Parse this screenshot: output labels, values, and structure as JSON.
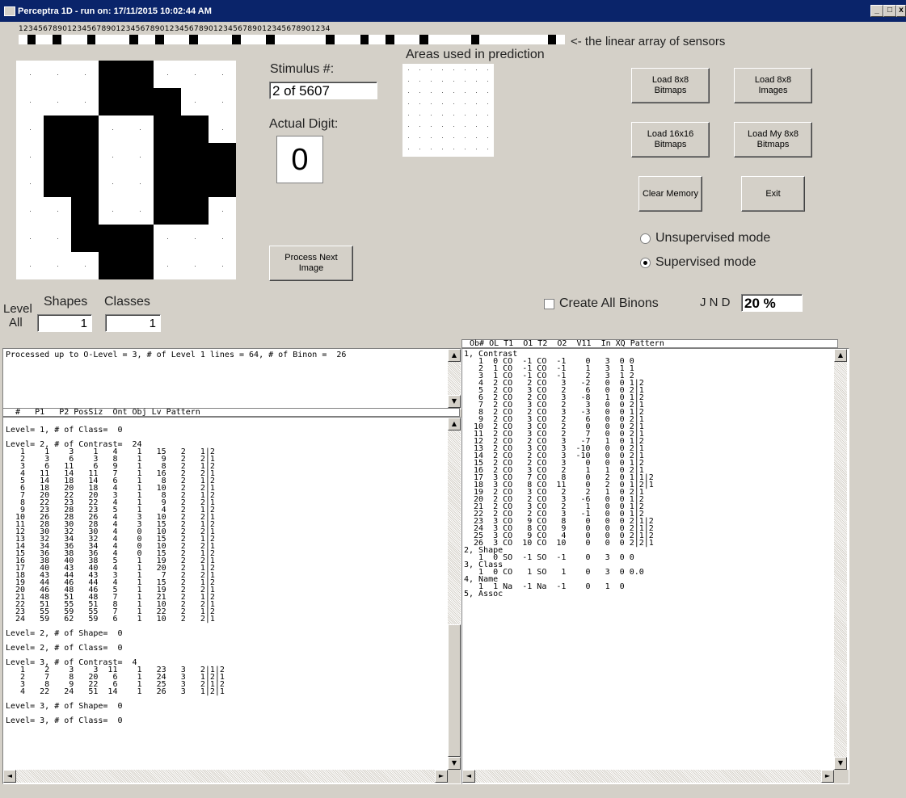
{
  "window": {
    "title": "Perceptra 1D - run on: 17/11/2015  10:02:44 AM"
  },
  "sensors": {
    "ruler_digits": "1234567890123456789012345678901234567890123456789012345678901234",
    "label": "<- the linear array of sensors",
    "pattern": "0100100010000100100010000100010000001000100100010000010000000010"
  },
  "bitmap": {
    "rows": [
      "00011000",
      "00011100",
      "01100110",
      "01100111",
      "01100111",
      "00100110",
      "00111000",
      "00011000"
    ]
  },
  "stimulus": {
    "label": "Stimulus #:",
    "value": "2  of 5607"
  },
  "actual_digit": {
    "label": "Actual Digit:",
    "value": "0"
  },
  "areas": {
    "label": "Areas used in prediction"
  },
  "buttons": {
    "load_8x8_bitmaps": "Load 8x8\nBitmaps",
    "load_8x8_images": "Load 8x8\nImages",
    "load_16x16_bitmaps": "Load 16x16\nBitmaps",
    "load_my_8x8_bitmaps": "Load My 8x8\nBitmaps",
    "clear_memory": "Clear Memory",
    "exit": "Exit",
    "process_next_image": "Process Next\nImage"
  },
  "modes": {
    "unsupervised": "Unsupervised mode",
    "supervised": "Supervised mode",
    "selected": "supervised"
  },
  "create_all_binons": {
    "label": "Create All Binons",
    "checked": false
  },
  "jnd": {
    "label": "J N D",
    "value": "20 %"
  },
  "level": {
    "label": "Level",
    "all": "All",
    "shapes_label": "Shapes",
    "shapes_value": "1",
    "classes_label": "Classes",
    "classes_value": "1"
  },
  "status": {
    "text": "Processed up to O-Level = 3, # of Level 1 lines = 64, # of Binon =  26"
  },
  "level_list": {
    "header": "  #   P1   P2 PosSiz  Ont Obj Lv Pattern",
    "text": "\nLevel= 1, # of Class=  0\n\nLevel= 2, # of Contrast=  24\n   1    1    3    1   4    1   15   2   1|2\n   2    3    6    3   8    1    9   2   2|1\n   3    6   11    6   9    1    8   2   1|2\n   4   11   14   11   7    1   16   2   2|1\n   5   14   18   14   6    1    8   2   1|2\n   6   18   20   18   4    1   10   2   2|1\n   7   20   22   20   3    1    8   2   1|2\n   8   22   23   22   4    1    9   2   2|1\n   9   23   28   23   5    1    4   2   1|2\n  10   26   28   26   4    3   10   2   2|1\n  11   28   30   28   4    3   15   2   1|2\n  12   30   32   30   4    0   10   2   2|1\n  13   32   34   32   4    0   15   2   1|2\n  14   34   36   34   4    0   10   2   2|1\n  15   36   38   36   4    0   15   2   1|2\n  16   38   40   38   5    1   19   2   2|1\n  17   40   43   40   4    1   20   2   1|2\n  18   43   44   43   3    1    7   2   2|1\n  19   44   46   44   4    1   15   2   1|2\n  20   46   48   46   5    1   19   2   2|1\n  21   48   51   48   7    1   21   2   1|2\n  22   51   55   51   8    1   10   2   2|1\n  23   55   59   55   7    1   22   2   1|2\n  24   59   62   59   6    1   10   2   2|1\n\nLevel= 2, # of Shape=  0\n\nLevel= 2, # of Class=  0\n\nLevel= 3, # of Contrast=  4\n   1    2    3    3  11    1   23   3   2|1|2\n   2    7    8   20   6    1   24   3   1|2|1\n   3    8    9   22   6    1   25   3   2|1|2\n   4   22   24   51  14    1   26   3   1|2|1\n\nLevel= 3, # of Shape=  0\n\nLevel= 3, # of Class=  0"
  },
  "object_list": {
    "header": " Ob# OL T1  O1 T2  O2  V11  In XQ Pattern",
    "text": "1, Contrast\n   1  0 CO  -1 CO  -1    0   3  0 0\n   2  1 CO  -1 CO  -1    1   3  1 1\n   3  1 CO  -1 CO  -1    2   3  1 2\n   4  2 CO   2 CO   3   -2   0  0 1|2\n   5  2 CO   3 CO   2    6   0  0 2|1\n   6  2 CO   2 CO   3   -8   1  0 1|2\n   7  2 CO   3 CO   2    3   0  0 2|1\n   8  2 CO   2 CO   3   -3   0  0 1|2\n   9  2 CO   3 CO   2    6   0  0 2|1\n  10  2 CO   3 CO   2    0   0  0 2|1\n  11  2 CO   3 CO   2    7   0  0 2|1\n  12  2 CO   2 CO   3   -7   1  0 1|2\n  13  2 CO   3 CO   3  -10   0  0 2|1\n  14  2 CO   2 CO   3  -10   0  0 2|1\n  15  2 CO   2 CO   3    0   0  0 1|2\n  16  2 CO   3 CO   2    1   1  0 2|1\n  17  3 CO   7 CO   8    0   2  0 1|1|2\n  18  3 CO   8 CO  11    0   2  0 1|2|1\n  19  2 CO   3 CO   2    2   1  0 2|1\n  20  2 CO   2 CO   3   -6   0  0 1|2\n  21  2 CO   3 CO   2    1   0  0 1|2\n  22  2 CO   2 CO   3   -1   0  0 1|2\n  23  3 CO   9 CO   8    0   0  0 2|1|2\n  24  3 CO   8 CO   9    0   0  0 2|1|2\n  25  3 CO   9 CO   4    0   0  0 2|1|2\n  26  3 CO  10 CO  10    0   0  0 2|2|1\n2, Shape\n   1  0 SO  -1 SO  -1    0   3  0 0\n3, Class\n   1  0 CO   1 SO   1    0   3  0 0.0\n4, Name\n   1  1 Na  -1 Na  -1    0   1  0\n5, Assoc"
  }
}
